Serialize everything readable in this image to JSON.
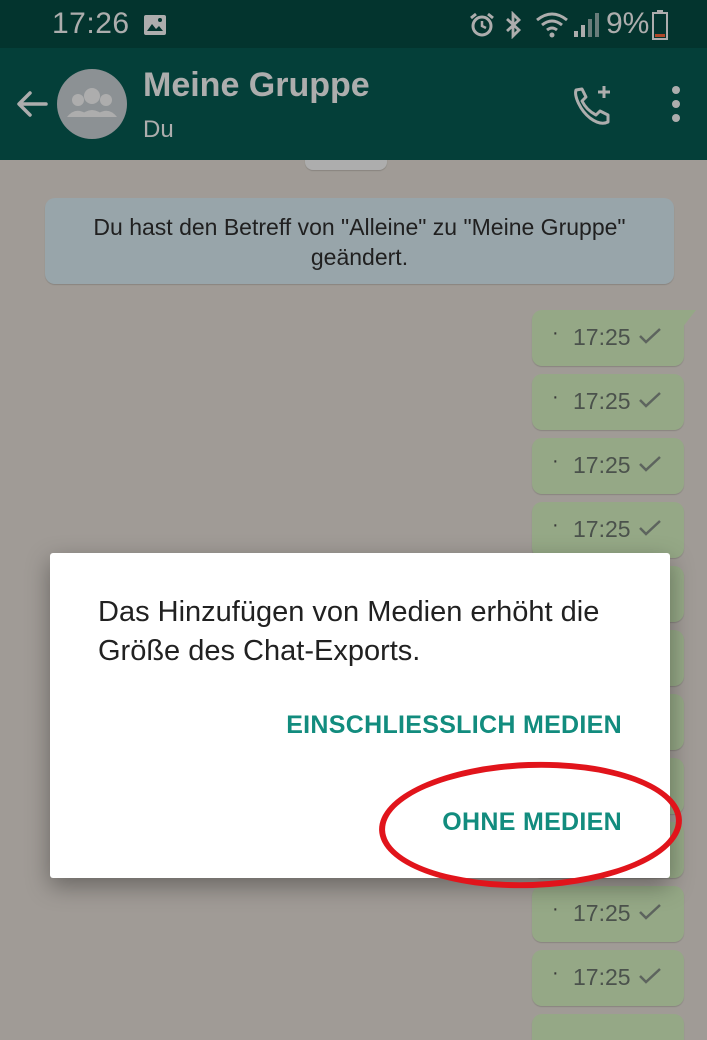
{
  "status_bar": {
    "time": "17:26",
    "battery": "9%",
    "icons": [
      "gallery-icon",
      "alarm-icon",
      "bluetooth-icon",
      "wifi-icon",
      "signal-icon",
      "battery-icon"
    ]
  },
  "app_bar": {
    "title": "Meine Gruppe",
    "subtitle": "Du",
    "icons": [
      "back-arrow-icon",
      "group-avatar-icon",
      "add-call-icon",
      "more-vert-icon"
    ]
  },
  "chat": {
    "system_message": "Du hast den Betreff von \"Alleine\" zu \"Meine Gruppe\" geändert.",
    "messages": [
      {
        "text": "·",
        "time": "17:25"
      },
      {
        "text": "·",
        "time": "17:25"
      },
      {
        "text": "·",
        "time": "17:25"
      },
      {
        "text": "·",
        "time": "17:25"
      },
      {
        "text": "·",
        "time": "17:25"
      },
      {
        "text": "·",
        "time": "17:25"
      }
    ]
  },
  "dialog": {
    "message": "Das Hinzufügen von Medien erhöht die Größe des Chat-Exports.",
    "include_media_label": "EINSCHLIESSLICH MEDIEN",
    "without_media_label": "OHNE MEDIEN"
  },
  "colors": {
    "header": "#075e54",
    "status_bar": "#054d44",
    "accent": "#128c7e",
    "outgoing_bubble": "#dcf8c6",
    "annotation": "#e1141b"
  }
}
